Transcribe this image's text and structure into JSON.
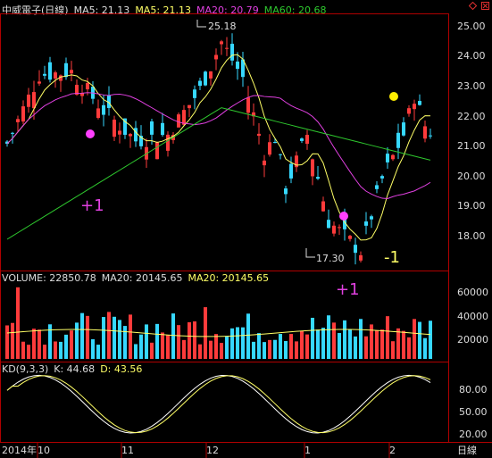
{
  "colors": {
    "bg": "#000000",
    "up": "#ff3b3b",
    "down": "#36d8ff",
    "ma5": "#ffff66",
    "ma20": "#e040e0",
    "ma60": "#2ec82e",
    "axis": "#b00000",
    "text": "#dddddd",
    "grid": "#7a0000"
  },
  "price_header": {
    "name": "中威電子(日線)",
    "ma5_label": "MA5: 21.13",
    "ma5b_label": "MA5: 21.13",
    "ma20_label": "MA20: 20.79",
    "ma60_label": "MA60: 20.68"
  },
  "price_axis": {
    "ticks": [
      "25.00",
      "24.00",
      "23.00",
      "22.00",
      "21.00",
      "20.00",
      "19.00",
      "18.00"
    ]
  },
  "high_label": "25.18",
  "low_label": "17.30",
  "markers": {
    "plus1_a": "+1",
    "minus1": "-1",
    "plus1_b": "+1"
  },
  "volume_header": {
    "volume_label": "VOLUME: 22850.78",
    "ma20_label": "MA20: 20145.65",
    "ma20b_label": "MA20: 20145.65"
  },
  "volume_axis": {
    "ticks": [
      "60000",
      "40000",
      "20000"
    ]
  },
  "kd_header": {
    "kd_label": "KD(9,3,3)",
    "k_label": "K: 44.68",
    "d_label": "D: 43.56"
  },
  "kd_axis": {
    "ticks": [
      "80.00",
      "50.00",
      "20.00"
    ]
  },
  "date_axis": {
    "labels": [
      "2014年",
      "10",
      "11",
      "12",
      "1",
      "2"
    ],
    "period": "日線"
  },
  "chart_data": {
    "type": "candlestick",
    "ylim": [
      17.0,
      25.5
    ],
    "high": 25.18,
    "low": 17.3,
    "volume_ylim": [
      0,
      70000
    ],
    "kd_ylim": [
      10,
      100
    ]
  }
}
